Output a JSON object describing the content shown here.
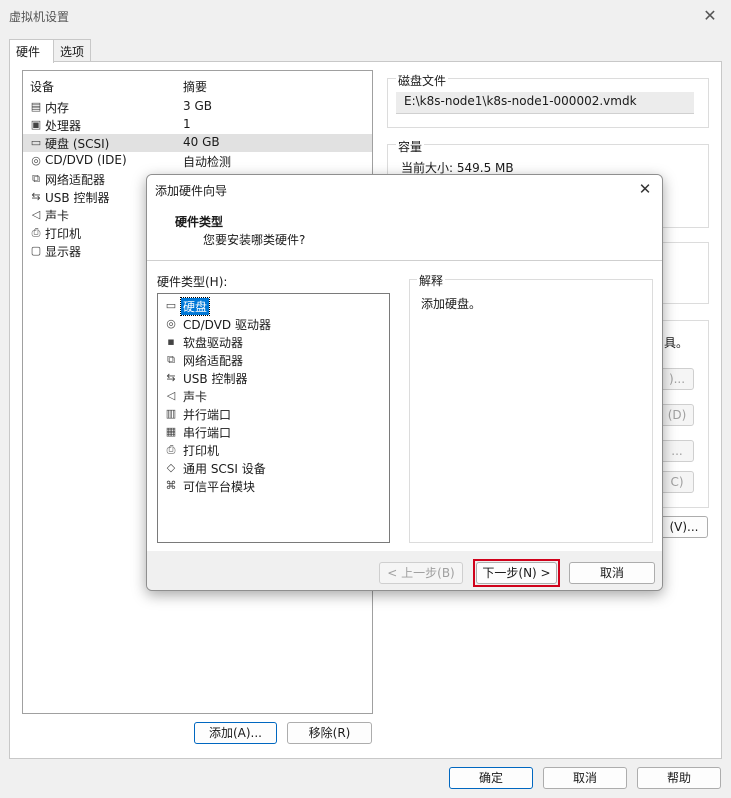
{
  "window": {
    "title": "虚拟机设置"
  },
  "tabs": [
    {
      "label": "硬件"
    },
    {
      "label": "选项"
    }
  ],
  "device_list": {
    "col_device": "设备",
    "col_summary": "摘要",
    "rows": [
      {
        "icon": "memory-icon",
        "name": "内存",
        "summary": "3 GB"
      },
      {
        "icon": "processor-icon",
        "name": "处理器",
        "summary": "1"
      },
      {
        "icon": "harddisk-icon",
        "name": "硬盘 (SCSI)",
        "summary": "40 GB"
      },
      {
        "icon": "cdrom-icon",
        "name": "CD/DVD (IDE)",
        "summary": "自动检测"
      },
      {
        "icon": "network-adapter-icon",
        "name": "网络适配器",
        "summary": ""
      },
      {
        "icon": "usb-icon",
        "name": "USB 控制器",
        "summary": ""
      },
      {
        "icon": "sound-icon",
        "name": "声卡",
        "summary": ""
      },
      {
        "icon": "printer-icon",
        "name": "打印机",
        "summary": ""
      },
      {
        "icon": "display-icon",
        "name": "显示器",
        "summary": ""
      }
    ],
    "add_button": "添加(A)...",
    "remove_button": "移除(R)"
  },
  "disk_file": {
    "label": "磁盘文件",
    "path": "E:\\k8s-node1\\k8s-node1-000002.vmdk"
  },
  "capacity": {
    "label": "容量",
    "current_size": "当前大小: 549.5 MB"
  },
  "partial_text": {
    "tools": "具。",
    "btn1": ")...",
    "btn2": "(D)",
    "btn3": "...",
    "btn4": "C)",
    "btn5": "(V)..."
  },
  "footer": {
    "ok": "确定",
    "cancel": "取消",
    "help": "帮助"
  },
  "wizard": {
    "title": "添加硬件向导",
    "heading": "硬件类型",
    "subheading": "您要安装哪类硬件?",
    "hw_type_label": "硬件类型(H):",
    "items": [
      {
        "icon": "harddisk-icon",
        "label": "硬盘"
      },
      {
        "icon": "cdrom-icon",
        "label": "CD/DVD 驱动器"
      },
      {
        "icon": "floppy-icon",
        "label": "软盘驱动器"
      },
      {
        "icon": "network-adapter-icon",
        "label": "网络适配器"
      },
      {
        "icon": "usb-icon",
        "label": "USB 控制器"
      },
      {
        "icon": "sound-icon",
        "label": "声卡"
      },
      {
        "icon": "parallel-port-icon",
        "label": "并行端口"
      },
      {
        "icon": "serial-port-icon",
        "label": "串行端口"
      },
      {
        "icon": "printer-icon",
        "label": "打印机"
      },
      {
        "icon": "scsi-icon",
        "label": "通用 SCSI 设备"
      },
      {
        "icon": "tpm-icon",
        "label": "可信平台模块"
      }
    ],
    "explanation_label": "解释",
    "explanation_text": "添加硬盘。",
    "back_button": "< 上一步(B)",
    "next_button": "下一步(N) >",
    "cancel_button": "取消"
  },
  "colors": {
    "accent": "#0078d7",
    "highlight": "#d0021b"
  }
}
